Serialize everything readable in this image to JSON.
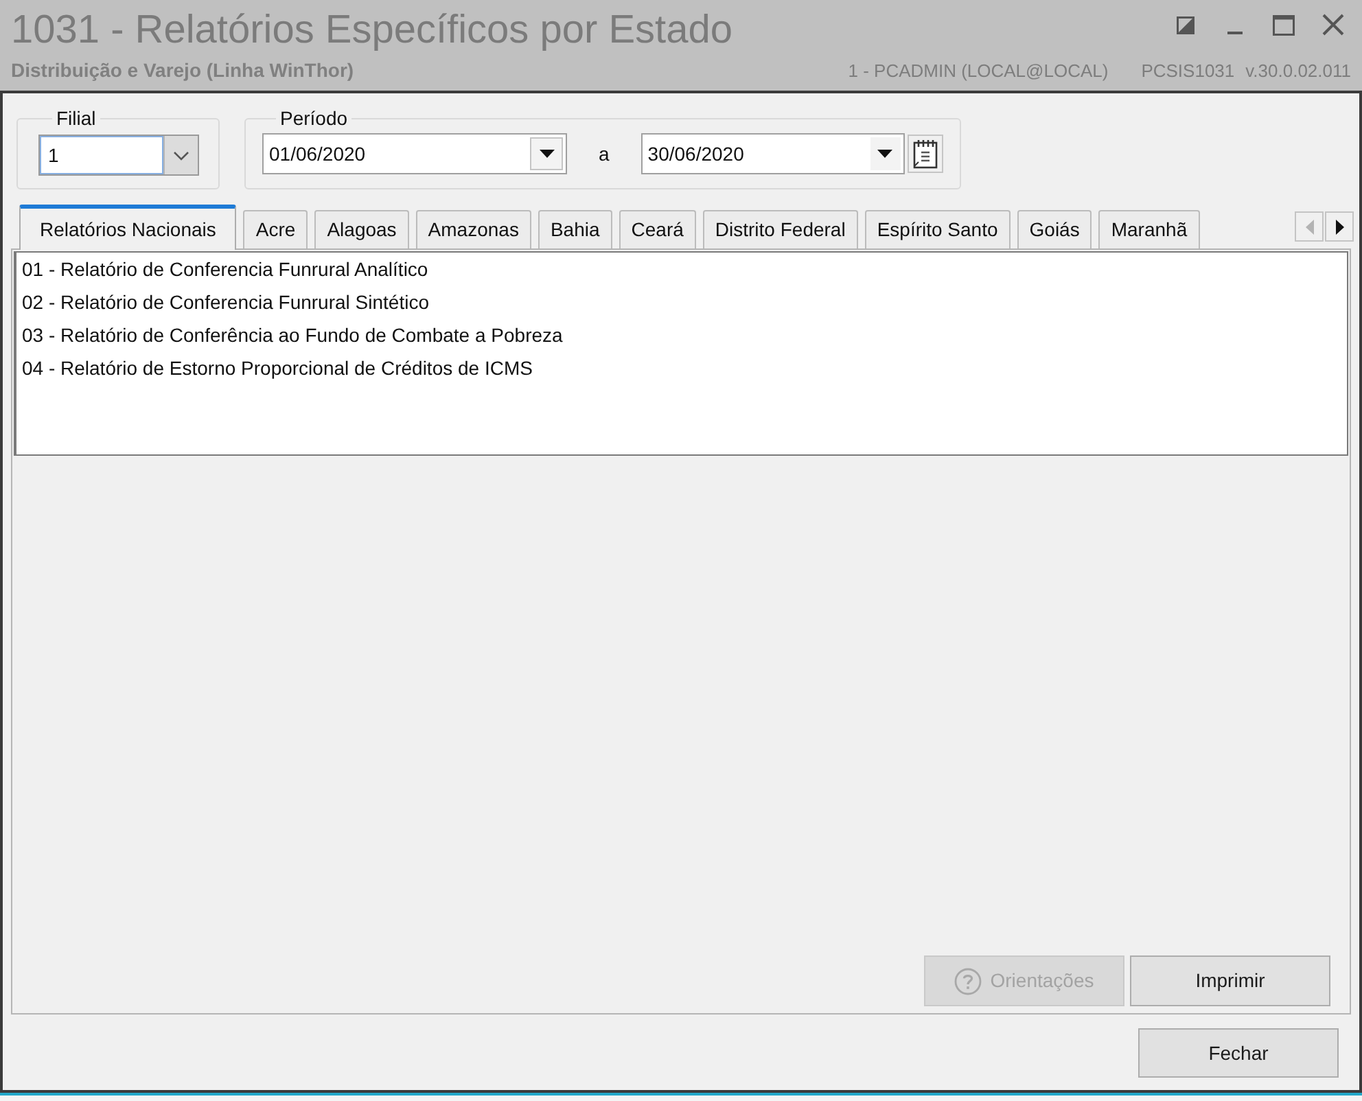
{
  "window": {
    "title": "1031 - Relatórios Específicos por Estado",
    "subtitle": "Distribuição e Varejo (Linha WinThor)",
    "user": "1 - PCADMIN (LOCAL@LOCAL)",
    "program": "PCSIS1031",
    "version": "v.30.0.02.011"
  },
  "filters": {
    "filial": {
      "label": "Filial",
      "value": "1"
    },
    "periodo": {
      "label": "Período",
      "start": "01/06/2020",
      "separator": "a",
      "end": "30/06/2020"
    }
  },
  "tabs": [
    {
      "label": "Relatórios Nacionais",
      "selected": true
    },
    {
      "label": "Acre",
      "selected": false
    },
    {
      "label": "Alagoas",
      "selected": false
    },
    {
      "label": "Amazonas",
      "selected": false
    },
    {
      "label": "Bahia",
      "selected": false
    },
    {
      "label": "Ceará",
      "selected": false
    },
    {
      "label": "Distrito Federal",
      "selected": false
    },
    {
      "label": "Espírito Santo",
      "selected": false
    },
    {
      "label": "Goiás",
      "selected": false
    },
    {
      "label": "Maranhã",
      "selected": false
    }
  ],
  "tab_scroll": {
    "back_disabled": true,
    "forward_disabled": false
  },
  "reports": [
    "01 - Relatório de Conferencia Funrural Analítico",
    "02 - Relatório de Conferencia Funrural Sintético",
    "03 - Relatório de Conferência ao Fundo de Combate a Pobreza",
    "04 - Relatório de Estorno Proporcional de Créditos de ICMS"
  ],
  "actions": [
    {
      "kind": "help",
      "label": "Orientações",
      "disabled": true
    },
    {
      "kind": "plain",
      "label": "Imprimir",
      "disabled": false
    }
  ],
  "footer_buttons": [
    {
      "label": "Fechar",
      "disabled": false
    }
  ]
}
